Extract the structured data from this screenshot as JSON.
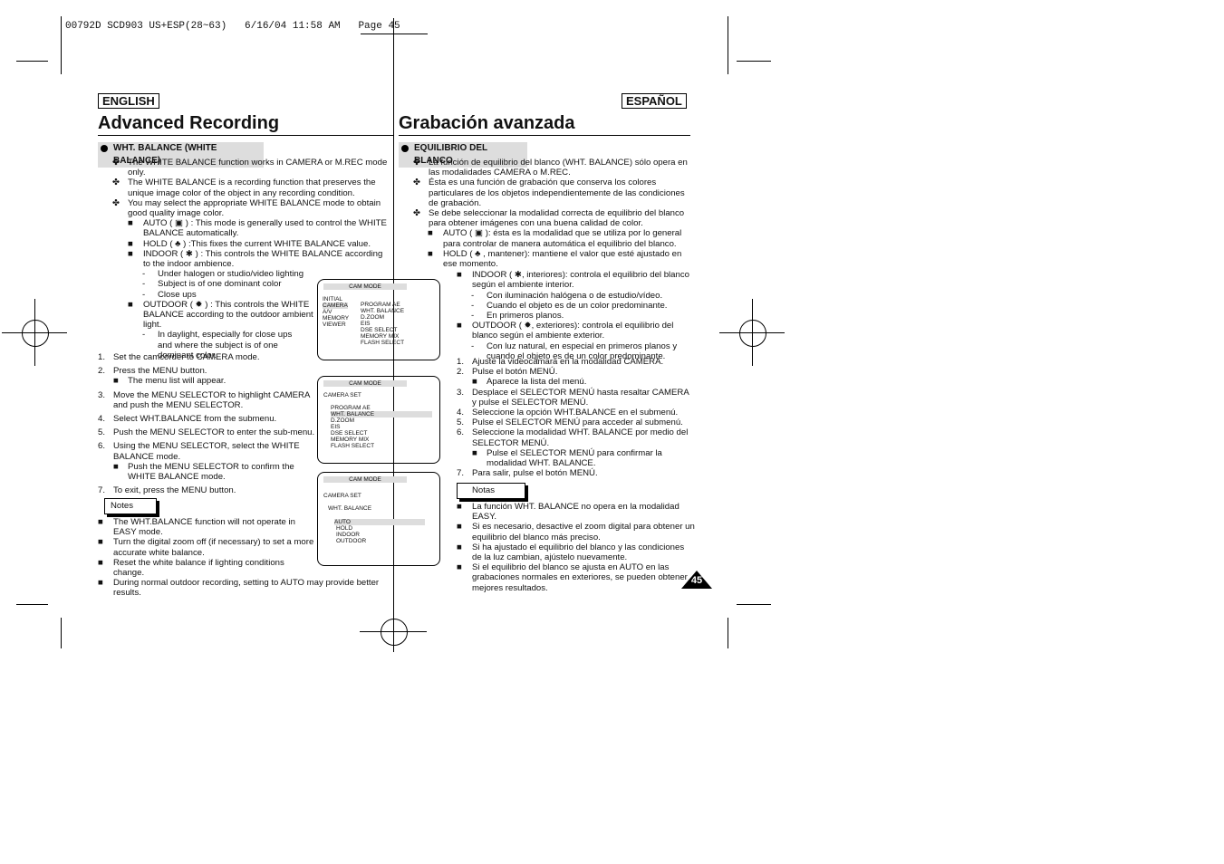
{
  "slug": "00792D SCD903 US+ESP(28~63)   6/16/04 11:58 AM   Page 45",
  "page_number": "45",
  "left": {
    "lang": "ENGLISH",
    "title": "Advanced Recording",
    "section": "WHT. BALANCE (WHITE BALANCE)",
    "bullets": [
      "The WHITE BALANCE function works in CAMERA or M.REC mode only.",
      "The WHITE BALANCE is a recording function that preserves the unique image color of the object in any recording condition.",
      "You may select the appropriate WHITE BALANCE mode to obtain good quality image color."
    ],
    "modes": [
      "AUTO ( ▣ ) : This mode is generally used to control the WHITE BALANCE automatically.",
      "HOLD ( ♣ ) :This fixes the current WHITE BALANCE value.",
      "INDOOR ( ✱ ) : This controls the WHITE BALANCE according to the indoor ambience."
    ],
    "indoor_subs": [
      "Under halogen or studio/video lighting",
      "Subject is of one dominant color",
      "Close ups"
    ],
    "outdoor": "OUTDOOR ( ✹ ) : This controls the WHITE BALANCE according to the outdoor ambient light.",
    "outdoor_sub": "In daylight, especially for close ups and where the subject is of one dominant color.",
    "steps": [
      "Set the camcorder to CAMERA mode.",
      "Press the MENU button.",
      "Move the MENU SELECTOR to highlight CAMERA and push the MENU SELECTOR.",
      "Select WHT.BALANCE from the submenu.",
      "Push the MENU SELECTOR to enter the sub-menu.",
      "Using the MENU SELECTOR, select the WHITE BALANCE mode.",
      "To exit, press the MENU button."
    ],
    "step2_sub": "The menu list will appear.",
    "step6_sub": "Push the MENU SELECTOR to confirm the WHITE BALANCE mode.",
    "notes_label": "Notes",
    "notes": [
      "The WHT.BALANCE function will not operate in EASY mode.",
      "Turn the digital zoom off (if necessary) to set a more accurate white balance.",
      "Reset the white balance if lighting conditions change.",
      "During normal outdoor recording, setting to AUTO may provide better results."
    ]
  },
  "right": {
    "lang": "ESPAÑOL",
    "title": "Grabación avanzada",
    "section": "EQUILIBRIO DEL BLANCO",
    "bullets": [
      "La función de equilibrio del blanco (WHT. BALANCE) sólo opera en las modalidades CAMERA o M.REC.",
      "Ésta es una función de grabación que conserva los colores particulares de los objetos independientemente de las condiciones de grabación.",
      "Se debe seleccionar la modalidad correcta de equilibrio del blanco para obtener imágenes con una buena calidad de color."
    ],
    "modes": [
      "AUTO ( ▣ ): ésta es la modalidad que se utiliza por lo general para controlar de manera automática el equilibrio del blanco.",
      "HOLD ( ♣ , mantener): mantiene el valor que esté ajustado en ese momento."
    ],
    "indoor": "INDOOR ( ✱, interiores): controla el equilibrio del blanco según el ambiente interior.",
    "indoor_subs": [
      "Con iluminación halógena o de estudio/vídeo.",
      "Cuando el objeto es de un color predominante.",
      "En primeros planos."
    ],
    "outdoor": "OUTDOOR ( ✹, exteriores): controla el equilibrio del blanco según el ambiente exterior.",
    "outdoor_sub": "Con luz natural, en especial en primeros planos y cuando el objeto es de un color predominante.",
    "steps": [
      "Ajuste la videocámara en la modalidad CAMERA.",
      "Pulse el botón MENÚ.",
      "Desplace el SELECTOR MENÚ hasta resaltar CAMERA y pulse el SELECTOR MENÚ.",
      "Seleccione la opción WHT.BALANCE en el submenú.",
      "Pulse el SELECTOR MENÚ para acceder al submenú.",
      "Seleccione la modalidad WHT. BALANCE por medio del SELECTOR MENÚ.",
      "Para salir, pulse el botón MENÚ."
    ],
    "step2_sub": "Aparece la lista del menú.",
    "step6_sub": "Pulse el SELECTOR MENÚ para confirmar la modalidad WHT. BALANCE.",
    "notes_label": "Notas",
    "notes": [
      "La función WHT. BALANCE no opera en la modalidad EASY.",
      "Si es necesario, desactive el zoom digital para obtener un equilibrio del blanco más preciso.",
      "Si ha ajustado el equilibrio del blanco y las condiciones de la luz cambian, ajústelo nuevamente.",
      "Si el equilibrio del blanco se ajusta en AUTO en las grabaciones normales en exteriores, se pueden obtener mejores resultados."
    ]
  },
  "screens": [
    {
      "header": "CAM MODE",
      "menu": [
        "INITIAL",
        "CAMERA",
        "A/V",
        "MEMORY",
        "VIEWER"
      ],
      "items": [
        "PROGRAM AE",
        "WHT. BALANCE",
        "D.ZOOM",
        "EIS",
        "DSE SELECT",
        "MEMORY MIX",
        "FLASH SELECT"
      ]
    },
    {
      "header": "CAM MODE",
      "group": "CAMERA SET",
      "items": [
        "PROGRAM AE",
        "WHT. BALANCE",
        "D.ZOOM",
        "EIS",
        "DSE SELECT",
        "MEMORY MIX",
        "FLASH SELECT"
      ]
    },
    {
      "header": "CAM MODE",
      "group": "CAMERA SET",
      "sub": "WHT. BALANCE",
      "items": [
        "AUTO",
        "HOLD",
        "INDOOR",
        "OUTDOOR"
      ]
    }
  ]
}
